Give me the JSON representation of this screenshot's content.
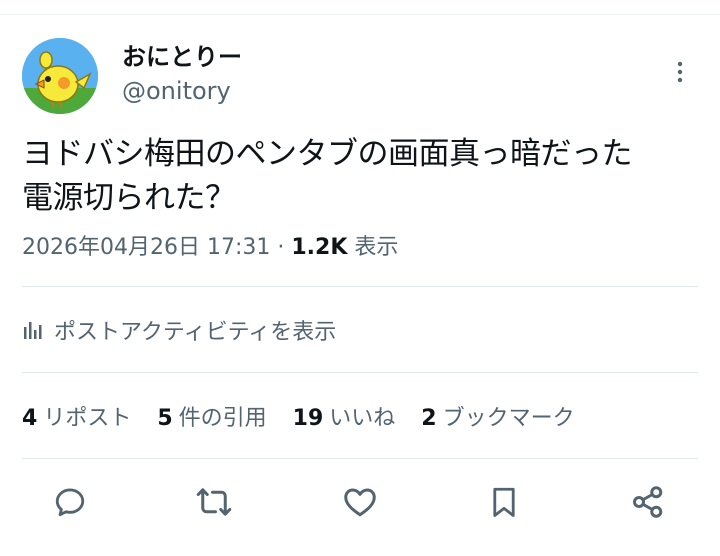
{
  "user": {
    "name": "おにとりー",
    "handle": "@onitory"
  },
  "tweet": {
    "lines": [
      "ヨドバシ梅田のペンタブの画面真っ暗だった",
      "電源切られた？"
    ]
  },
  "meta": {
    "datetime": "2026年04月26日 17:31",
    "separator": "·",
    "views_count": "1.2K",
    "views_label": "表示"
  },
  "activity": {
    "label": "ポストアクティビティを表示"
  },
  "stats": [
    {
      "count": "4",
      "label": "リポスト"
    },
    {
      "count": "5",
      "label": "件の引用"
    },
    {
      "count": "19",
      "label": "いいね"
    },
    {
      "count": "2",
      "label": "ブックマーク"
    }
  ],
  "icons": [
    "more-vert-icon",
    "activity-chart-icon",
    "reply-icon",
    "retweet-icon",
    "like-icon",
    "bookmark-icon",
    "share-icon"
  ],
  "colors": {
    "text": "#0f1419",
    "secondary": "#536471",
    "divider": "#e1e8ed"
  }
}
